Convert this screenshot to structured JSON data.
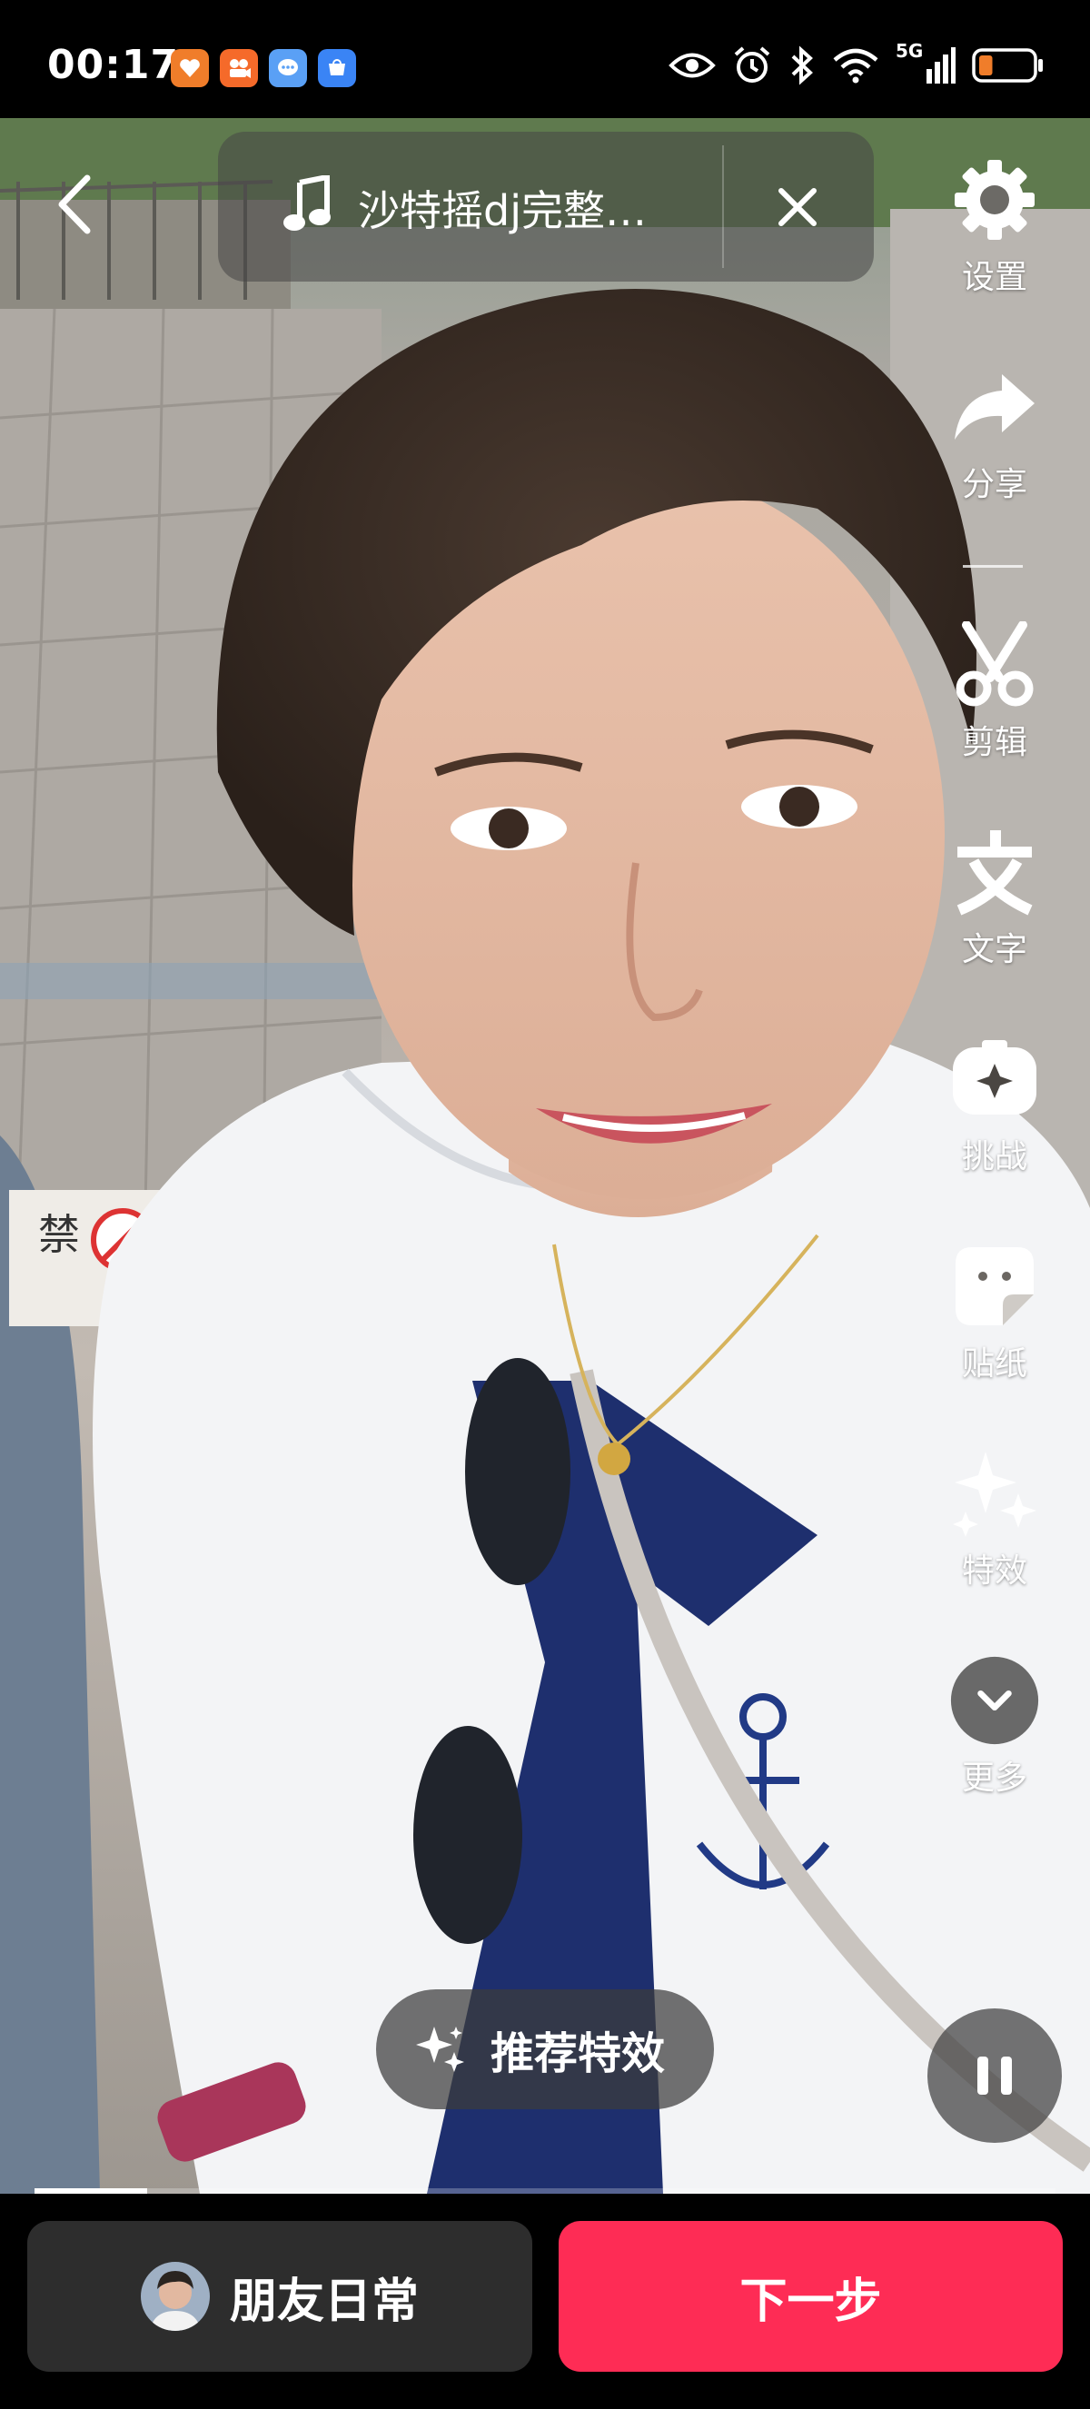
{
  "status_bar": {
    "time": "00:17",
    "notification_icons": [
      "heart-app-icon",
      "video-app-icon",
      "chat-app-icon",
      "store-app-icon"
    ],
    "notification_colors": [
      "#f07d2a",
      "#f56a2a",
      "#5aa0f5",
      "#3a84f5"
    ],
    "network_label": "5G",
    "system_icons": [
      "eye-icon",
      "alarm-icon",
      "bluetooth-icon",
      "wifi-icon",
      "signal-icon",
      "battery-icon"
    ],
    "battery_level": 0.25,
    "battery_color": "#f07d2a"
  },
  "header": {
    "back_icon": "chevron-left-icon",
    "music_icon": "music-note-icon",
    "music_title": "沙特摇dj完整…",
    "close_icon": "close-icon"
  },
  "toolbar": {
    "items": [
      {
        "label": "设置",
        "icon": "gear-icon"
      },
      {
        "label": "分享",
        "icon": "share-arrow-icon"
      },
      {
        "label": "剪辑",
        "icon": "scissors-icon"
      },
      {
        "label": "文字",
        "icon": "text-icon"
      },
      {
        "label": "挑战",
        "icon": "challenge-icon"
      },
      {
        "label": "贴纸",
        "icon": "sticker-icon"
      },
      {
        "label": "特效",
        "icon": "sparkle-icon"
      },
      {
        "label": "更多",
        "icon": "chevron-down-icon"
      }
    ]
  },
  "recommend": {
    "label": "推荐特效",
    "icon": "sparkle-icon"
  },
  "playback": {
    "pause_icon": "pause-icon",
    "progress": 0.11
  },
  "bottom": {
    "friends_label": "朋友日常",
    "next_label": "下一步",
    "next_color": "#fe2c55"
  },
  "scene": {
    "sign_text": "禁"
  }
}
